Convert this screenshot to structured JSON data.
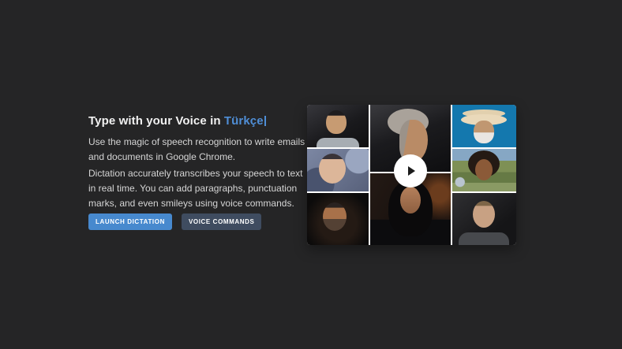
{
  "page": {
    "background_color": "#252526"
  },
  "hero": {
    "heading": {
      "prefix": "Type with your Voice in ",
      "language": "Türkçe",
      "language_color": "#4f8ed6"
    },
    "paragraphs": {
      "p1": "Use the magic of speech recognition to write emails and documents in Google Chrome.",
      "p2": "Dictation accurately transcribes your speech to text in real time. You can add paragraphs, punctuation marks, and even smileys using voice commands."
    },
    "buttons": {
      "launch": {
        "label": "LAUNCH DICTATION",
        "color": "#4789ce"
      },
      "voice": {
        "label": "VOICE COMMANDS",
        "color": "#3f4c60"
      }
    }
  },
  "video": {
    "play_icon": "play-triangle",
    "portraits": [
      {
        "name": "asian-man-portrait",
        "position": "left-top"
      },
      {
        "name": "headscarf-woman-portrait",
        "position": "left-middle"
      },
      {
        "name": "smiling-bearded-man-portrait",
        "position": "left-bottom"
      },
      {
        "name": "elderly-man-profile-portrait",
        "position": "middle-top"
      },
      {
        "name": "dark-haired-woman-portrait",
        "position": "middle-bottom"
      },
      {
        "name": "man-with-hat-sunglasses-portrait",
        "position": "right-top"
      },
      {
        "name": "curly-hair-woman-portrait",
        "position": "right-middle"
      },
      {
        "name": "hoodie-man-portrait",
        "position": "right-bottom"
      }
    ]
  }
}
